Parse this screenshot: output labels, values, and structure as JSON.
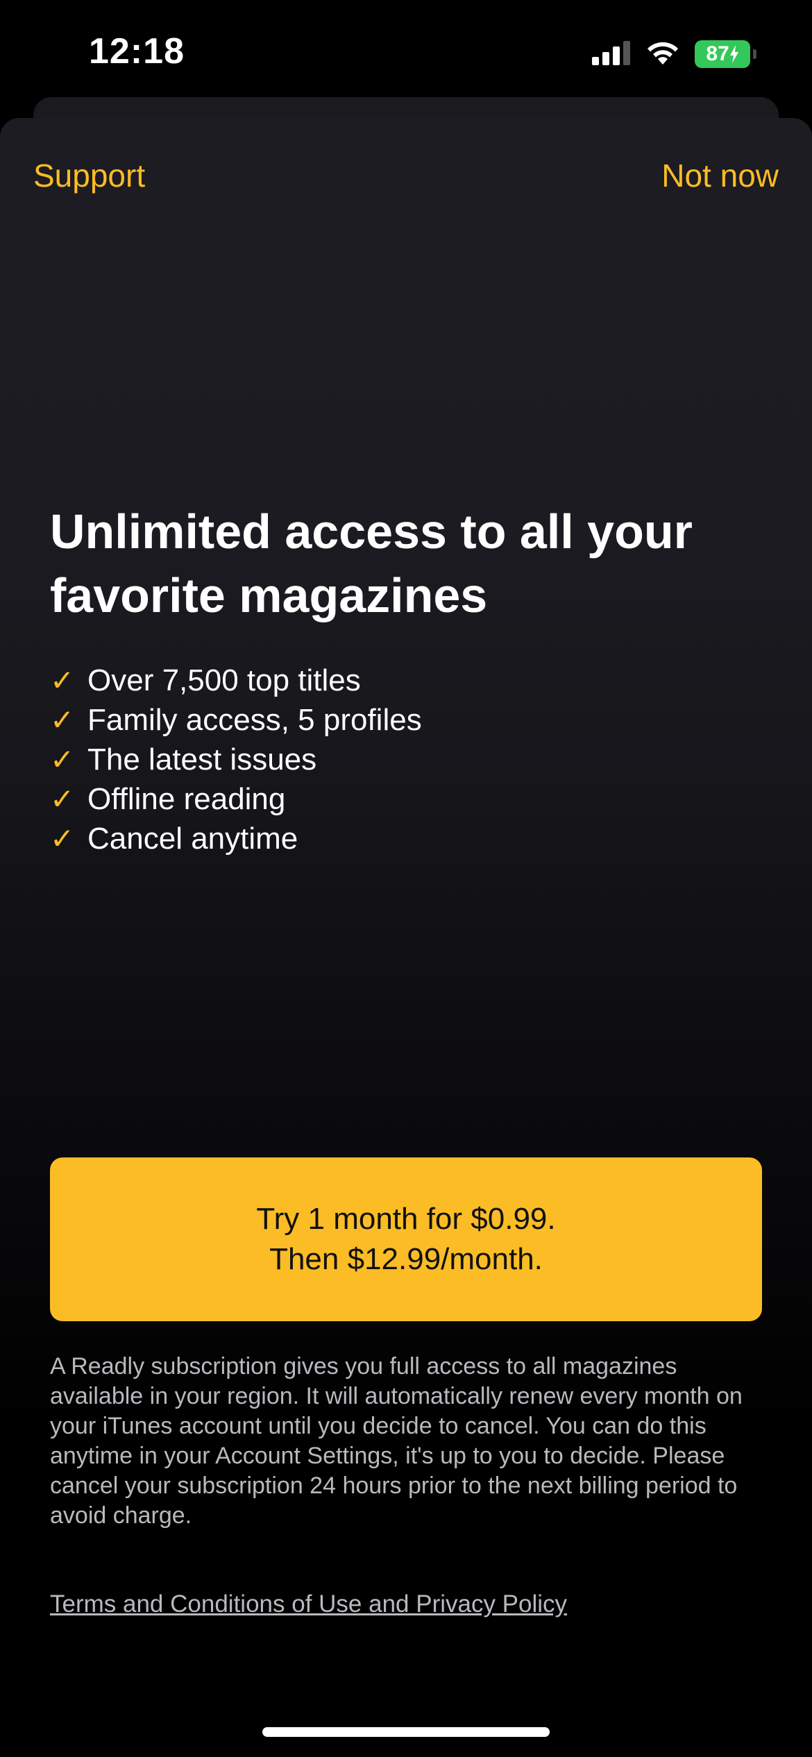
{
  "status_bar": {
    "time": "12:18",
    "battery_level": "87",
    "icons": [
      "cellular-signal-icon",
      "wifi-icon",
      "battery-charging-icon"
    ]
  },
  "header": {
    "support_label": "Support",
    "not_now_label": "Not now"
  },
  "main": {
    "headline": "Unlimited access to all your favorite magazines",
    "features": [
      "Over 7,500 top titles",
      "Family access, 5 profiles",
      "The latest issues",
      "Offline reading",
      "Cancel anytime"
    ],
    "check_glyph": "✓"
  },
  "cta": {
    "line1": "Try 1 month for $0.99.",
    "line2": "Then $12.99/month."
  },
  "fine_print": "A Readly subscription gives you full access to all magazines available in your region. It will automatically renew every month on your iTunes account until you decide to cancel. You can do this anytime in your Account Settings, it's up to you to decide. Please cancel your subscription 24 hours prior to the next billing period to avoid charge.",
  "terms_link": "Terms and Conditions of Use and Privacy Policy",
  "colors": {
    "accent": "#fbbc25",
    "background": "#000000",
    "sheet": "#1c1c22",
    "battery": "#34c759"
  }
}
